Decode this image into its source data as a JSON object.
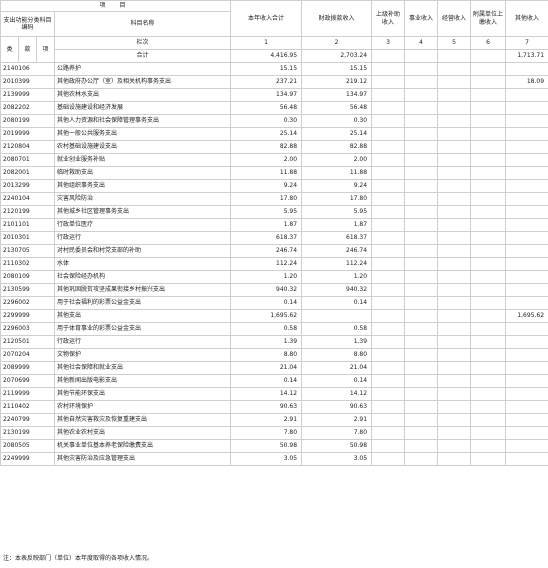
{
  "header": {
    "project_title": "项 目",
    "func_class_label": "支出功能分类科目编码",
    "subject_name": "科目名称",
    "total_income": "本年收入合计",
    "fiscal_grant": "财政拨款收入",
    "superior_subsidy": "上级补助收入",
    "business_income": "事业收入",
    "operating_income": "经营收入",
    "affiliated_remit": "附属单位上缴收入",
    "other_income": "其他收入",
    "lei": "类",
    "kuan": "款",
    "xiang": "项",
    "col_order": "栏次",
    "col_nums": [
      "1",
      "2",
      "3",
      "4",
      "5",
      "6",
      "7"
    ],
    "total_label": "合计",
    "total_values": [
      "4,416.95",
      "2,703.24",
      "",
      "",
      "",
      "",
      "1,713.71"
    ]
  },
  "rows": [
    {
      "code": "2140106",
      "name": "公路养护",
      "total": "15.15",
      "fiscal": "15.15",
      "other": ""
    },
    {
      "code": "2010399",
      "name": "其他政府办公厅（室）及相关机构事务支出",
      "total": "237.21",
      "fiscal": "219.12",
      "other": "18.09"
    },
    {
      "code": "2139999",
      "name": "其他农林水支出",
      "total": "134.97",
      "fiscal": "134.97",
      "other": ""
    },
    {
      "code": "2082202",
      "name": "基础设施建设和经济发展",
      "total": "56.48",
      "fiscal": "56.48",
      "other": ""
    },
    {
      "code": "2080199",
      "name": "其他人力资源和社会保障管理事务支出",
      "total": "0.30",
      "fiscal": "0.30",
      "other": ""
    },
    {
      "code": "2019999",
      "name": "其他一般公共服务支出",
      "total": "25.14",
      "fiscal": "25.14",
      "other": ""
    },
    {
      "code": "2120804",
      "name": "农村基础设施建设支出",
      "total": "82.88",
      "fiscal": "82.88",
      "other": ""
    },
    {
      "code": "2080701",
      "name": "就业创业服务补贴",
      "total": "2.00",
      "fiscal": "2.00",
      "other": ""
    },
    {
      "code": "2082001",
      "name": "临时救助支出",
      "total": "11.88",
      "fiscal": "11.88",
      "other": ""
    },
    {
      "code": "2013299",
      "name": "其他组织事务支出",
      "total": "9.24",
      "fiscal": "9.24",
      "other": ""
    },
    {
      "code": "2240104",
      "name": "灾害风险防治",
      "total": "17.80",
      "fiscal": "17.80",
      "other": ""
    },
    {
      "code": "2120199",
      "name": "其他城乡社区管理事务支出",
      "total": "5.95",
      "fiscal": "5.95",
      "other": ""
    },
    {
      "code": "2101101",
      "name": "行政单位医疗",
      "total": "1.87",
      "fiscal": "1.87",
      "other": ""
    },
    {
      "code": "2010301",
      "name": "行政运行",
      "total": "618.37",
      "fiscal": "618.37",
      "other": ""
    },
    {
      "code": "2130705",
      "name": "对村民委员会和村党支部的补助",
      "total": "246.74",
      "fiscal": "246.74",
      "other": ""
    },
    {
      "code": "2110302",
      "name": "水体",
      "total": "112.24",
      "fiscal": "112.24",
      "other": ""
    },
    {
      "code": "2080109",
      "name": "社会保险经办机构",
      "total": "1.20",
      "fiscal": "1.20",
      "other": ""
    },
    {
      "code": "2130599",
      "name": "其他巩固脱贫攻坚成果衔接乡村振兴支出",
      "total": "940.32",
      "fiscal": "940.32",
      "other": ""
    },
    {
      "code": "2296002",
      "name": "用于社会福利的彩票公益金支出",
      "total": "0.14",
      "fiscal": "0.14",
      "other": ""
    },
    {
      "code": "2299999",
      "name": "其他支出",
      "total": "1,695.62",
      "fiscal": "",
      "other": "1,695.62"
    },
    {
      "code": "2296003",
      "name": "用于体育事业的彩票公益金支出",
      "total": "0.58",
      "fiscal": "0.58",
      "other": ""
    },
    {
      "code": "2120501",
      "name": "行政运行",
      "total": "1.39",
      "fiscal": "1.39",
      "other": ""
    },
    {
      "code": "2070204",
      "name": "文物保护",
      "total": "8.80",
      "fiscal": "8.80",
      "other": ""
    },
    {
      "code": "2089999",
      "name": "其他社会保障和就业支出",
      "total": "21.04",
      "fiscal": "21.04",
      "other": ""
    },
    {
      "code": "2070699",
      "name": "其他新闻出版电影支出",
      "total": "0.14",
      "fiscal": "0.14",
      "other": ""
    },
    {
      "code": "2119999",
      "name": "其他节能环保支出",
      "total": "14.12",
      "fiscal": "14.12",
      "other": ""
    },
    {
      "code": "2110402",
      "name": "农村环境保护",
      "total": "90.63",
      "fiscal": "90.63",
      "other": ""
    },
    {
      "code": "2240799",
      "name": "其他自然灾害救灾及恢复重建支出",
      "total": "2.91",
      "fiscal": "2.91",
      "other": ""
    },
    {
      "code": "2130199",
      "name": "其他农业农村支出",
      "total": "7.80",
      "fiscal": "7.80",
      "other": ""
    },
    {
      "code": "2080505",
      "name": "机关事业单位基本养老保险缴费支出",
      "total": "50.98",
      "fiscal": "50.98",
      "other": ""
    },
    {
      "code": "2249999",
      "name": "其他灾害防治及应急管理支出",
      "total": "3.05",
      "fiscal": "3.05",
      "other": ""
    }
  ],
  "footnote": "注：本表反映部门（单位）本年度取得的各项收入情况。"
}
